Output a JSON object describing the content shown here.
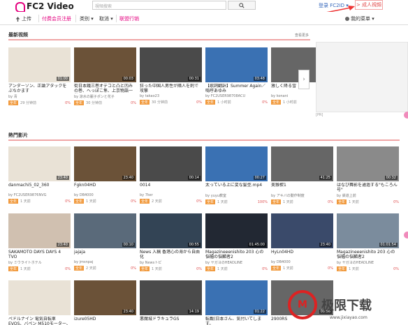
{
  "header": {
    "logo": "FC2 Video",
    "search_placeholder": "視頻搜索",
    "login": "登录 FC2ID ▾",
    "adult": "> 成人視頻"
  },
  "nav": {
    "upload": "上传",
    "premium": "付费会员注册",
    "category": "类别 ▾",
    "ranking": "取消 ▾",
    "affiliate": "联盟行销",
    "my_list": "我的菜单 ▾"
  },
  "latest": {
    "title": "最新视频",
    "more": "查看更多",
    "cards": [
      {
        "title": "アンダーソン、正論アタックをぶちかます",
        "user": "by 青",
        "tag": "全年",
        "duration": "01:00",
        "meta": "29 分钟前",
        "pct": "0%"
      },
      {
        "title": "街日本鐵三巻オデコと凸と凹みの巻、へっぽこ隼、上京物語一巻",
        "user": "by 涼水の麗子ポンと花子",
        "tag": "全年",
        "duration": "00:03",
        "meta": "30 分钟前",
        "pct": "0%"
      },
      {
        "title": "狂った中国人男性が隣人を刺で攻撃",
        "user": "by takao23",
        "tag": "全年",
        "duration": "00:31",
        "meta": "30 分钟前",
        "pct": "0%"
      },
      {
        "title": "【歌詞翻訳】Summer Again／嗚呼あゆみ",
        "user": "by FC2USER98708ACU",
        "tag": "全年",
        "duration": "03:48",
        "meta": "1 小时前",
        "pct": "0%"
      },
      {
        "title": "激しく降る雪",
        "user": "by konani",
        "tag": "全年",
        "duration": "",
        "meta": "1 小时前",
        "pct": "0%"
      }
    ]
  },
  "popular": {
    "title": "熱門影片",
    "row1": [
      {
        "title": "danmachi5_02_360",
        "user": "by FC2USER9876NVG",
        "tag": "全年",
        "duration": "23:40",
        "meta": "1 天前",
        "pct": "0%"
      },
      {
        "title": "Fgkn04HD",
        "user": "by DB4000",
        "tag": "全年",
        "duration": "23:40",
        "meta": "1 天前",
        "pct": "0%"
      },
      {
        "title": "0014",
        "user": "by 7ker",
        "tag": "全年",
        "duration": "00:14",
        "meta": "2 天前",
        "pct": "0%"
      },
      {
        "title": "太っている上に変な髪型.mp4",
        "user": "by yuyu教室",
        "tag": "全年",
        "duration": "00:27",
        "meta": "1 天前",
        "pct": "100%"
      },
      {
        "title": "美猴楔1",
        "user": "by アキバの動作制度",
        "tag": "全年",
        "duration": "41:25",
        "meta": "1 天前",
        "pct": "0%"
      },
      {
        "title": "はなび舞影を通過する\"もころん号\"",
        "user": "by 鉄道上前",
        "tag": "全年",
        "duration": "00:32",
        "meta": "1 天前",
        "pct": "0%"
      }
    ],
    "row2": [
      {
        "title": "SAKAMOTO DAYS DAYS 4 TVO",
        "user": "by ミウライトホテル",
        "tag": "全年",
        "duration": "23:40",
        "meta": "1 天前",
        "pct": "0%"
      },
      {
        "title": "jajaja",
        "user": "by jmsnpaj",
        "tag": "全年",
        "duration": "00:10",
        "meta": "2 天前",
        "pct": "0%"
      },
      {
        "title": "News 入稿 香港心の海から自由化",
        "user": "by Newsトピ",
        "tag": "全年",
        "duration": "00:55",
        "meta": "1 天前",
        "pct": "0%"
      },
      {
        "title": "Magazineeenishito 203 心の悩幅の悩麟者2",
        "user": "by ヤガヨのHEADLINE",
        "tag": "全年",
        "duration": "01:45:00",
        "meta": "1 天前",
        "pct": "0%"
      },
      {
        "title": "HyLn04HD",
        "user": "by DB4000",
        "tag": "全年",
        "duration": "23:40",
        "meta": "1 天前",
        "pct": "0%"
      },
      {
        "title": "Magazineeenishito 203 心の悩幅の悩麟者2",
        "user": "by ヤガヨのHEADLINE",
        "tag": "全年",
        "duration": "01:01:54",
        "meta": "1 天前",
        "pct": "0%"
      }
    ],
    "row3": [
      {
        "title": "ペドルナイン 電気自転車 EVOS、バペン M510モーター、ホイー...",
        "user": "",
        "duration": "",
        "meta": "",
        "pct": ""
      },
      {
        "title": "izure05HD",
        "user": "",
        "duration": "23:40",
        "meta": "",
        "pct": ""
      },
      {
        "title": "悪魔城ドラキュラGS",
        "user": "",
        "duration": "14:19",
        "meta": "",
        "pct": ""
      },
      {
        "title": "転載(日本さん、気付いてします。",
        "user": "",
        "duration": "01:22",
        "meta": "",
        "pct": ""
      },
      {
        "title": "2900RS",
        "user": "",
        "duration": "00:56",
        "meta": "",
        "pct": ""
      },
      {
        "title": "",
        "user": "",
        "duration": "",
        "meta": "",
        "pct": ""
      }
    ]
  },
  "side": {
    "ad_label": "[PR]"
  },
  "watermark": {
    "mark": "M",
    "text": "极限下载",
    "sub": "www.jixiayao.com"
  }
}
